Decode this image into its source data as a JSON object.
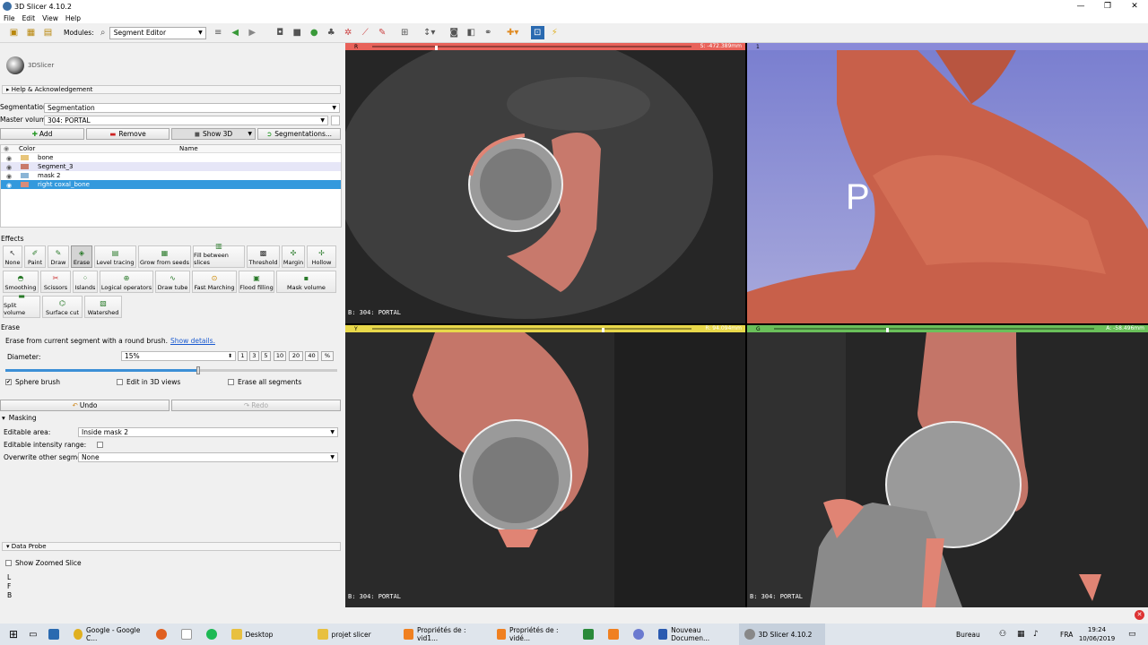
{
  "window": {
    "title": "3D Slicer 4.10.2",
    "minimize": "—",
    "maximize": "❐",
    "close": "✕"
  },
  "menu": [
    "File",
    "Edit",
    "View",
    "Help"
  ],
  "toolbar": {
    "modules_label": "Modules:",
    "module_value": "Segment Editor"
  },
  "logo_text": "3DSlicer",
  "help_section": "Help & Acknowledgement",
  "segmentation": {
    "label": "Segmentation:",
    "value": "Segmentation"
  },
  "master_volume": {
    "label": "Master volume:",
    "value": "304: PORTAL"
  },
  "buttons": {
    "add": "Add",
    "remove": "Remove",
    "show3d": "Show 3D",
    "segmentations": "Segmentations..."
  },
  "table": {
    "col_color": "Color",
    "col_name": "Name",
    "rows": [
      {
        "name": "bone",
        "color": "#e8c57a"
      },
      {
        "name": "Segment_3",
        "color": "#c97a6a"
      },
      {
        "name": "mask 2",
        "color": "#8ab4d6"
      },
      {
        "name": "right coxal_bone",
        "color": "#d98c7a"
      }
    ]
  },
  "effects": {
    "label": "Effects",
    "items": [
      "None",
      "Paint",
      "Draw",
      "Erase",
      "Level tracing",
      "Grow from seeds",
      "Fill between slices",
      "Threshold",
      "Margin",
      "Hollow",
      "Smoothing",
      "Scissors",
      "Islands",
      "Logical operators",
      "Draw tube",
      "Fast Marching",
      "Flood filling",
      "Mask volume",
      "Split volume",
      "Surface cut",
      "Watershed"
    ]
  },
  "erase": {
    "title": "Erase",
    "desc": "Erase from current segment with a round brush.",
    "link": "Show details.",
    "diameter_label": "Diameter:",
    "diameter_value": "15%",
    "presets": [
      "1",
      "3",
      "5",
      "10",
      "20",
      "40",
      "%"
    ],
    "slider_pct": 58,
    "sphere_brush": "Sphere brush",
    "edit3d": "Edit in 3D views",
    "erase_all": "Erase all segments",
    "undo": "Undo",
    "redo": "Redo"
  },
  "masking": {
    "title": "Masking",
    "editable_area_label": "Editable area:",
    "editable_area_value": "Inside mask 2",
    "intensity_label": "Editable intensity range:",
    "overwrite_label": "Overwrite other segments:",
    "overwrite_value": "None"
  },
  "data_probe": {
    "title": "Data Probe",
    "show_zoomed": "Show Zoomed Slice",
    "l": "L",
    "f": "F",
    "b": "B"
  },
  "views": {
    "red": {
      "letter": "R",
      "value": "S: -472.389mm",
      "label": "B: 304: PORTAL",
      "color": "#e8625a"
    },
    "threed": {
      "letter": "1",
      "overlay": "P",
      "color": "#8a8ad8"
    },
    "yellow": {
      "letter": "Y",
      "value": "R: 94.094mm",
      "label": "B: 304: PORTAL",
      "color": "#e8d84a"
    },
    "green": {
      "letter": "G",
      "value": "A: -58.496mm",
      "label": "B: 304: PORTAL",
      "color": "#6ac05a"
    }
  },
  "taskbar": {
    "items": [
      "Google - Google C...",
      "Desktop",
      "projet slicer",
      "Propriétés de : vid1...",
      "Propriétés de : vidé...",
      "Nouveau Documen...",
      "3D Slicer 4.10.2"
    ],
    "desktop_label": "Bureau",
    "lang": "FRA",
    "time": "19:24",
    "date": "10/06/2019"
  }
}
